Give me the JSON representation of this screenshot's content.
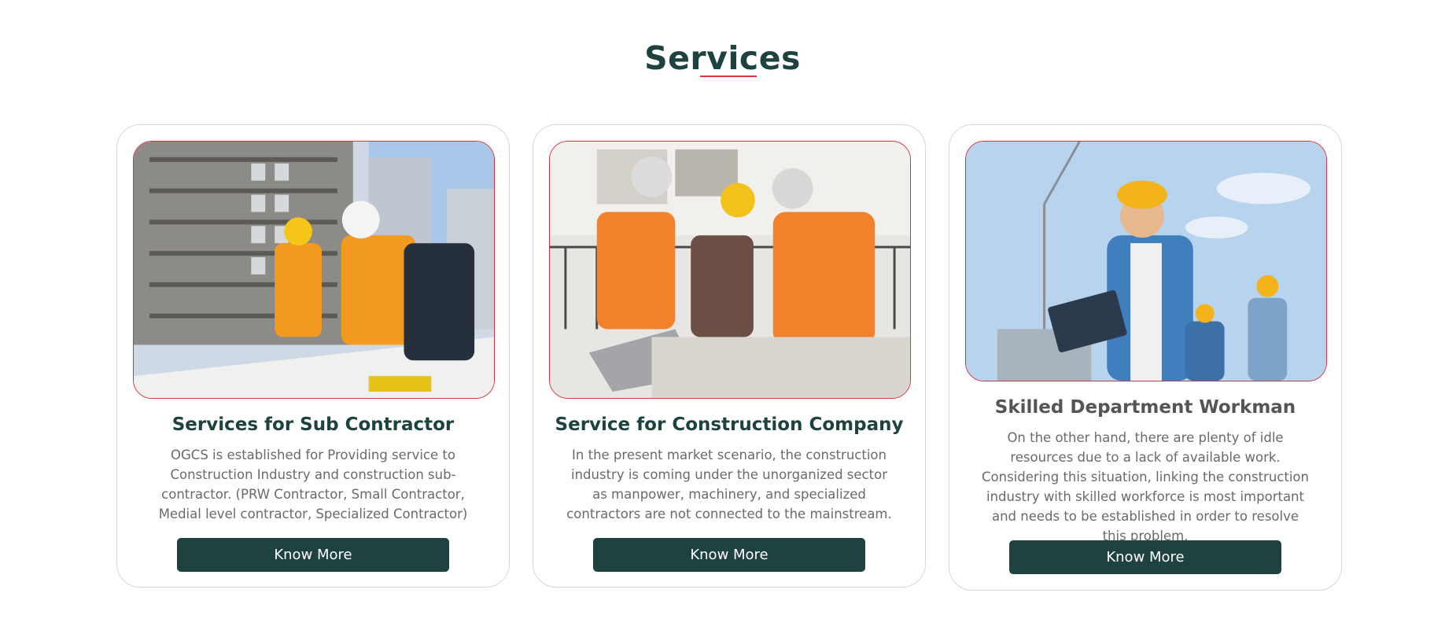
{
  "section": {
    "title": "Services"
  },
  "cards": [
    {
      "title": "Services for Sub Contractor",
      "title_color": "#1d4240",
      "text": "OGCS is established for Providing service to Construction Industry and construction sub-contractor. (PRW Contractor, Small Contractor, Medial level contractor, Specialized Contractor)",
      "button": "Know More",
      "image_alt": "Two construction workers in hard hats reviewing blueprints at a building site"
    },
    {
      "title": "Service for Construction Company",
      "title_color": "#1d4240",
      "text": "In the present market scenario, the construction industry is coming under the unorganized sector as manpower, machinery, and specialized contractors are not connected to the mainstream.",
      "button": "Know More",
      "image_alt": "Three engineers discussing plans over a laptop at a construction site"
    },
    {
      "title": "Skilled Department Workman",
      "title_color": "#555555",
      "text": "On the other hand, there are plenty of idle resources due to a lack of available work. Considering this situation, linking the construction industry with skilled workforce is most important and needs to be established in order to resolve this problem.",
      "button": "Know More",
      "image_alt": "Smiling construction worker holding a clipboard with a crane in the background"
    }
  ],
  "colors": {
    "primary": "#1d4240",
    "accent": "#e2333f",
    "text": "#6a6a6a",
    "border": "#d8d8d8"
  }
}
